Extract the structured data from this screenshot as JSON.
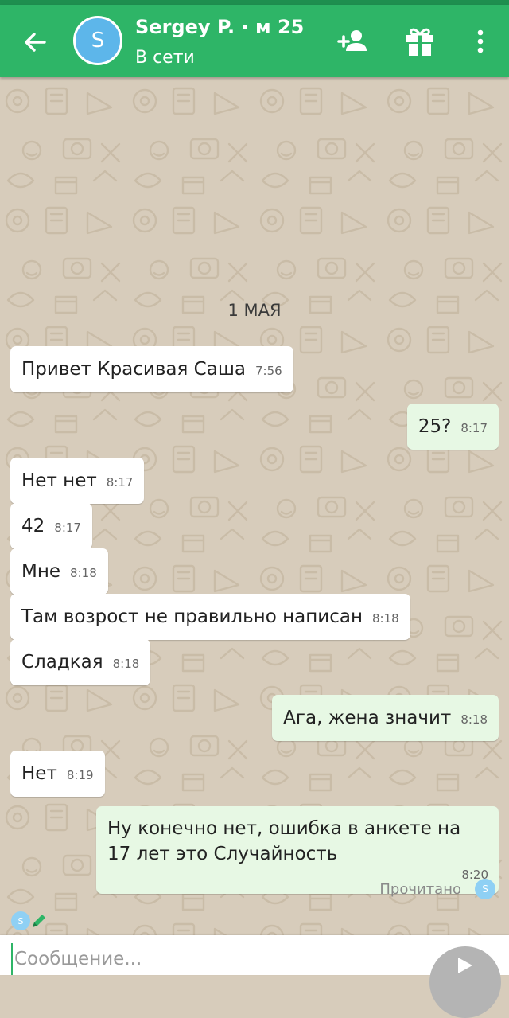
{
  "header": {
    "avatar_letter": "S",
    "name": "Sergey P. · м 25",
    "status": "В сети",
    "accent_color": "#2eb567"
  },
  "icons": {
    "back": "arrow-back-icon",
    "add_contact": "person-add-icon",
    "gift": "gift-icon",
    "menu": "more-vert-icon",
    "typing": "pencil-icon",
    "send": "send-icon"
  },
  "chat": {
    "date_separator": "1 МАЯ",
    "messages": [
      {
        "dir": "in",
        "text": "Привет Красивая Саша",
        "time": "7:56"
      },
      {
        "dir": "out",
        "text": "25?",
        "time": "8:17"
      },
      {
        "dir": "in",
        "text": "Нет нет",
        "time": "8:17"
      },
      {
        "dir": "in",
        "text": "42",
        "time": "8:17"
      },
      {
        "dir": "in",
        "text": "Мне",
        "time": "8:18"
      },
      {
        "dir": "in",
        "text": "Там возрост не правильно написан",
        "time": "8:18"
      },
      {
        "dir": "in",
        "text": "Сладкая",
        "time": "8:18"
      },
      {
        "dir": "out",
        "text": "Ага, жена значит",
        "time": "8:18"
      },
      {
        "dir": "in",
        "text": "Нет",
        "time": "8:19"
      },
      {
        "dir": "out",
        "text": "Ну конечно нет, ошибка в анкете на 17 лет это Случайность",
        "time": "8:20"
      }
    ],
    "read_status": "Прочитано",
    "read_avatar_letter": "S",
    "typing_avatar_letter": "S"
  },
  "input": {
    "placeholder": "Сообщение..."
  }
}
